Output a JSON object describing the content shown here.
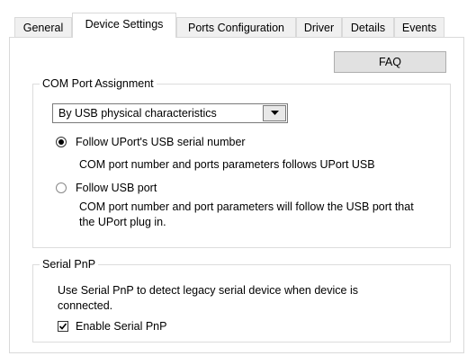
{
  "tabs": [
    {
      "label": "General"
    },
    {
      "label": "Device Settings",
      "active": true
    },
    {
      "label": "Ports Configuration"
    },
    {
      "label": "Driver"
    },
    {
      "label": "Details"
    },
    {
      "label": "Events"
    }
  ],
  "faq_button": "FAQ",
  "com_port": {
    "group_title": "COM Port Assignment",
    "dropdown_value": "By USB physical characteristics",
    "option_serial": {
      "label": "Follow UPort's USB serial number",
      "checked": true,
      "description": "COM port number and ports parameters follows UPort USB"
    },
    "option_usb_port": {
      "label": "Follow USB port",
      "checked": false,
      "description_line1": "COM port number and port parameters will follow the USB port that",
      "description_line2": "the UPort plug in."
    }
  },
  "serial_pnp": {
    "group_title": "Serial PnP",
    "description_line1": "Use Serial PnP to detect legacy serial device when device is",
    "description_line2": "connected.",
    "checkbox_label": "Enable Serial PnP",
    "checked": true
  },
  "icons": {
    "dropdown": "chevron-down-icon",
    "checkbox": "check-icon"
  }
}
